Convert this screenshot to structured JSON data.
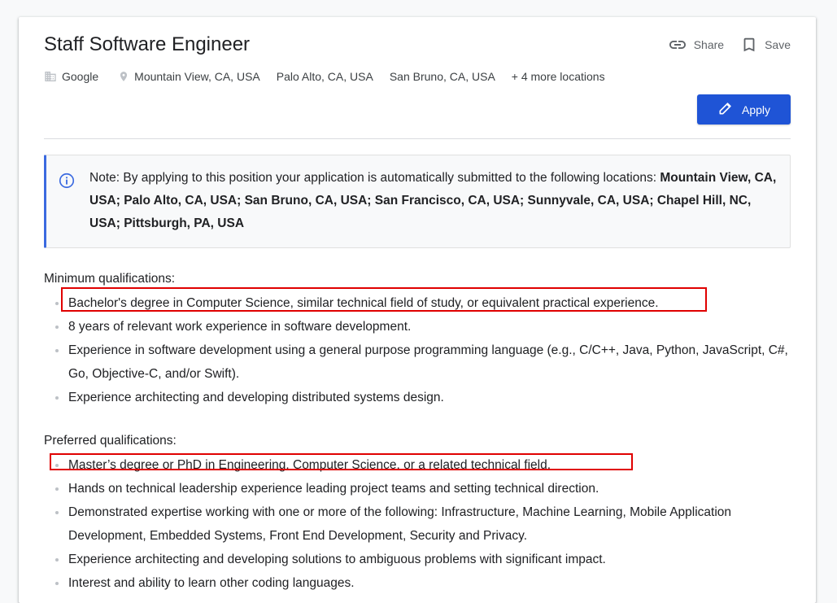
{
  "job": {
    "title": "Staff Software Engineer",
    "share_label": "Share",
    "save_label": "Save",
    "company": "Google",
    "locations": [
      "Mountain View, CA, USA",
      "Palo Alto, CA, USA",
      "San Bruno, CA, USA"
    ],
    "more_locations": "+ 4 more locations",
    "apply_label": "Apply"
  },
  "note": {
    "prefix": "Note: By applying to this position your application is automatically submitted to the following locations: ",
    "locations_bold": "Mountain View, CA, USA; Palo Alto, CA, USA; San Bruno, CA, USA; San Francisco, CA, USA; Sunnyvale, CA, USA; Chapel Hill, NC, USA; Pittsburgh, PA, USA"
  },
  "minimum": {
    "title": "Minimum qualifications:",
    "items": [
      "Bachelor's degree in Computer Science, similar technical field of study, or equivalent practical experience.",
      "8 years of relevant work experience in software development.",
      "Experience in software development using a general purpose programming language (e.g., C/C++, Java, Python, JavaScript, C#, Go, Objective-C, and/or Swift).",
      "Experience architecting and developing distributed systems design."
    ]
  },
  "preferred": {
    "title": "Preferred qualifications:",
    "items": [
      "Master’s degree or PhD in Engineering, Computer Science, or a related technical field.",
      "Hands on technical leadership experience leading project teams and setting technical direction.",
      "Demonstrated expertise working with one or more of the following: Infrastructure, Machine Learning, Mobile Application Development, Embedded Systems, Front End Development, Security and Privacy.",
      "Experience architecting and developing solutions to ambiguous problems with significant impact.",
      "Interest and ability to learn other coding languages."
    ]
  },
  "colors": {
    "apply_button": "#1f54d6",
    "note_accent": "#3b6ae0",
    "highlight_box": "#e00000"
  }
}
